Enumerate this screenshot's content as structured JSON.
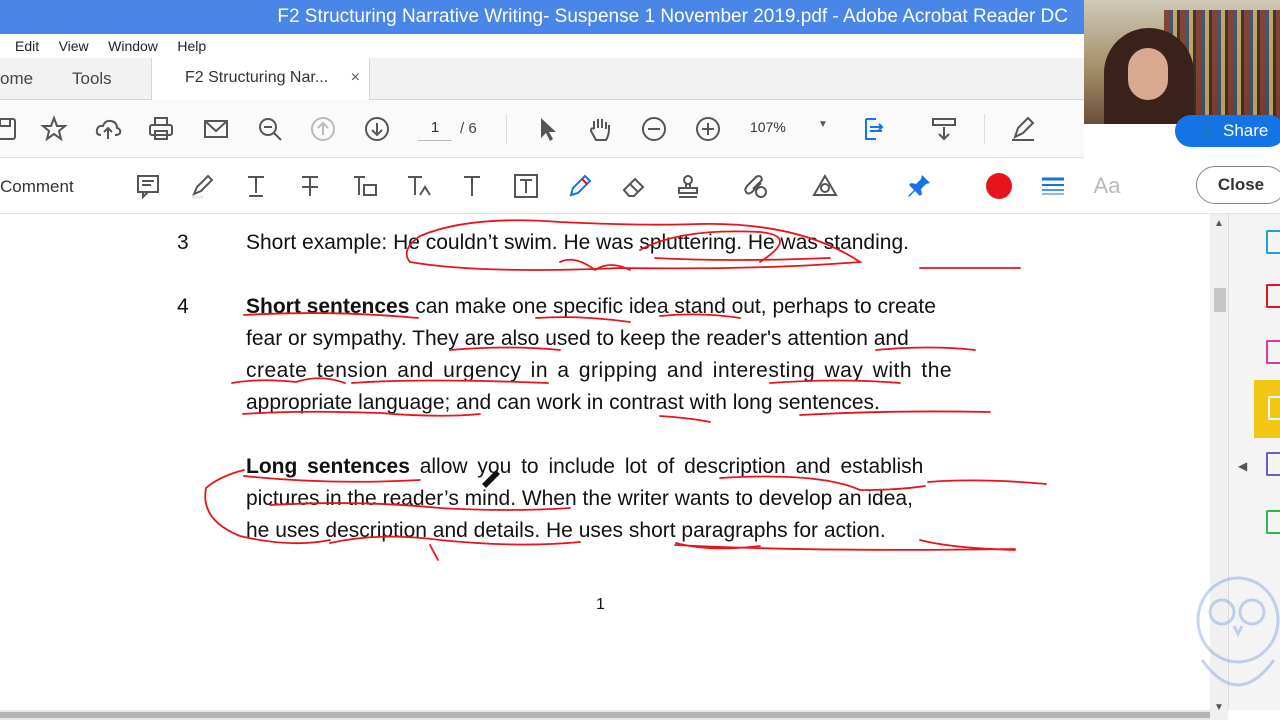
{
  "window": {
    "title": "F2  Structuring Narrative Writing- Suspense 1 November 2019.pdf - Adobe Acrobat Reader DC"
  },
  "menu": {
    "items": [
      "Edit",
      "View",
      "Window",
      "Help"
    ]
  },
  "tabs": {
    "home": "ome",
    "tools": "Tools",
    "document": "F2  Structuring Nar...",
    "close_glyph": "×"
  },
  "toolbar": {
    "page_current": "1",
    "page_total": "/ 6",
    "zoom": "107%",
    "icons": [
      "save-icon",
      "bookmark-star-icon",
      "upload-cloud-icon",
      "print-icon",
      "email-icon",
      "search-zoom-icon",
      "page-up-icon",
      "page-down-icon",
      "select-cursor-icon",
      "hand-pan-icon",
      "zoom-out-icon",
      "zoom-in-icon",
      "fit-page-icon",
      "scroll-mode-icon",
      "sign-icon"
    ]
  },
  "commentbar": {
    "label": "Comment",
    "close_label": "Close",
    "text_glyph": "Aa",
    "icons": [
      "sticky-note-icon",
      "highlight-icon",
      "text-underline-icon",
      "strikethrough-icon",
      "replace-text-icon",
      "insert-text-icon",
      "add-text-icon",
      "text-box-icon",
      "draw-pencil-icon",
      "eraser-icon",
      "stamp-icon",
      "attach-icon",
      "shapes-icon",
      "pin-icon",
      "color-icon",
      "line-weight-icon",
      "font-size-icon"
    ],
    "ink_color": "#e8141b"
  },
  "share": {
    "label": "Share"
  },
  "document": {
    "item3_num": "3",
    "item3_text": "Short example:  He couldn’t swim.  He was spluttering.  He was standing.",
    "item4_num": "4",
    "item4_bold": "Short sentences",
    "item4_line1_rest": " can make one specific idea stand out, perhaps to create",
    "item4_line2": "fear or sympathy.  They are also used to keep the reader's attention and",
    "item4_line3": "create tension and urgency in a gripping and interesting way with the",
    "item4_line4": "appropriate language; and can work in contrast with long sentences.",
    "long_bold": "Long sentences",
    "long_line1_rest": " allow you to include lot of description and establish",
    "long_line2": "pictures in the reader’s mind. When the writer wants to develop an idea,",
    "long_line3": "he uses description and details. He uses short paragraphs for action.",
    "page_number": "1"
  }
}
